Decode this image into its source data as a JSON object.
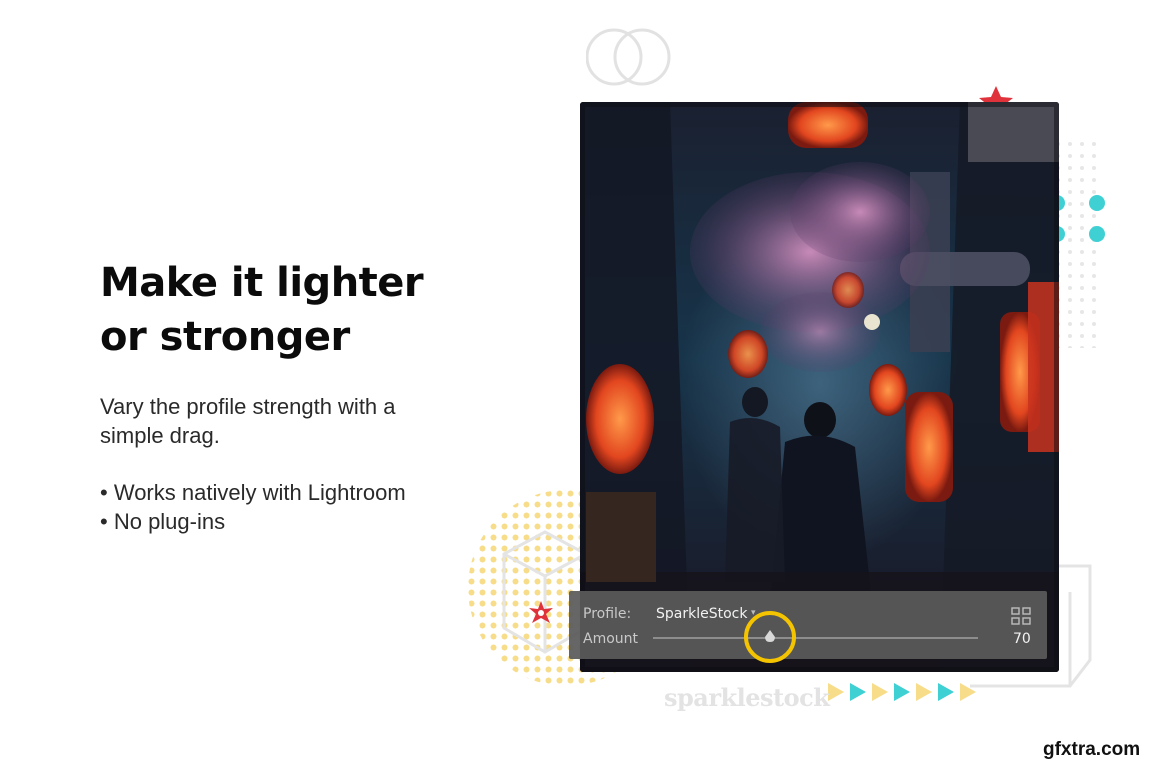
{
  "headline": {
    "line1": "Make it lighter",
    "line2": "or stronger"
  },
  "subtext": {
    "line1": "Vary the profile strength with a",
    "line2": "simple drag."
  },
  "bullets": [
    "Works natively with Lightroom",
    "No plug-ins"
  ],
  "panel": {
    "profile_label": "Profile:",
    "profile_value": "SparkleStock",
    "amount_label": "Amount",
    "amount_value": "70",
    "amount_fraction": 0.36,
    "browse_icon": "grid-icon"
  },
  "brand": {
    "name": "sparklestock"
  },
  "watermark": {
    "text": "gfxtra.com"
  },
  "colors": {
    "highlight_ring": "#f5c400",
    "accent_cyan": "#3fd0d4",
    "accent_red": "#e0323a",
    "accent_yellow": "#f7dc8a"
  }
}
